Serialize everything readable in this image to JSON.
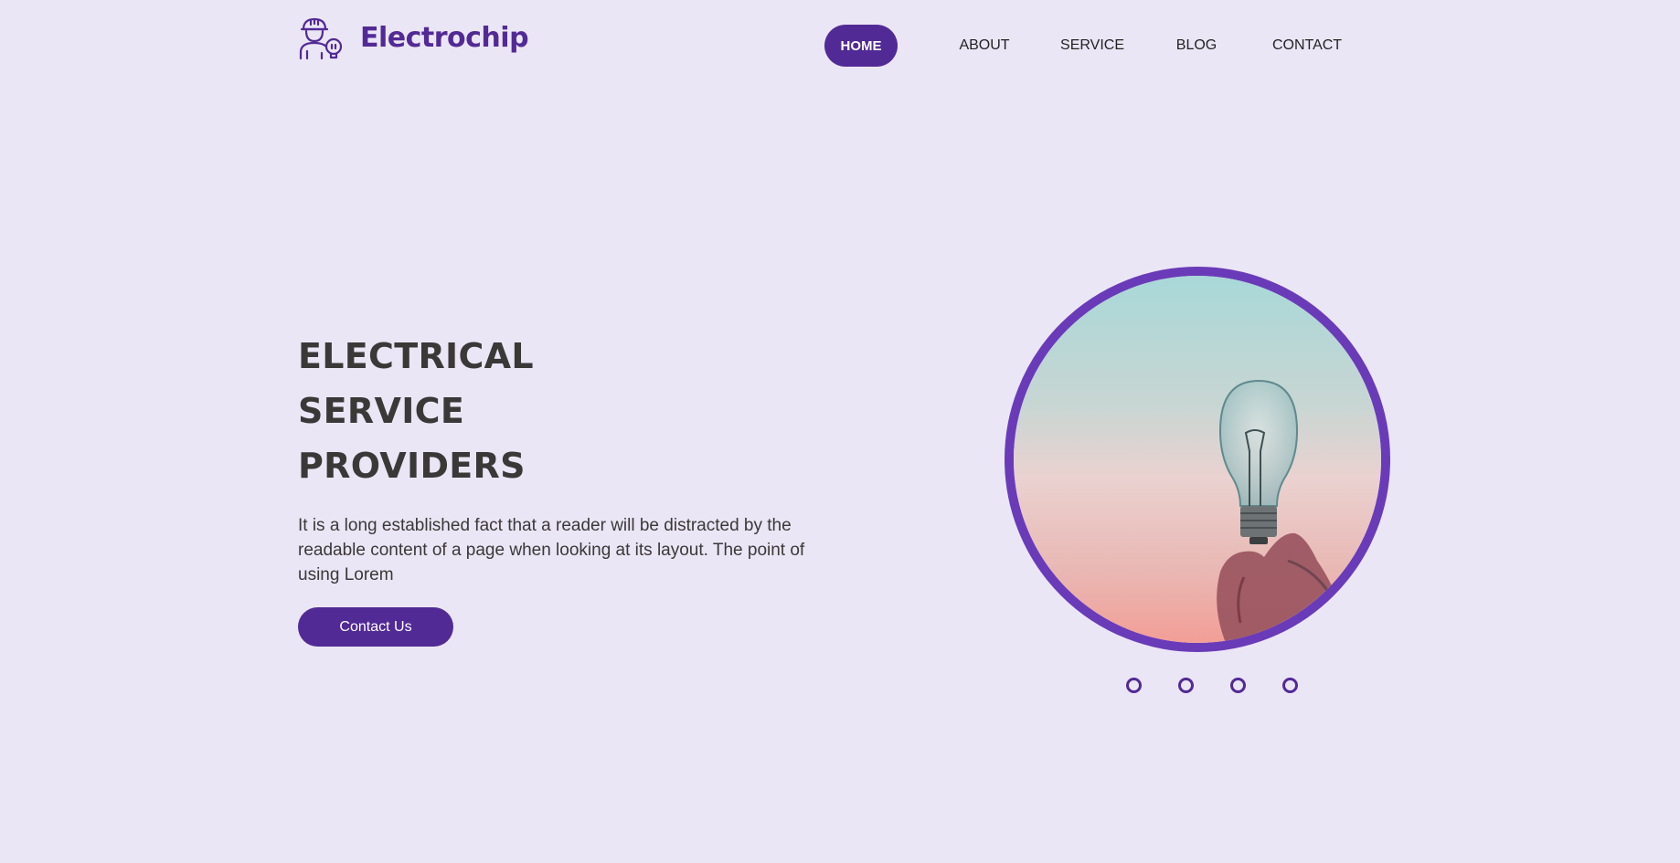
{
  "brand": {
    "name": "Electrochip",
    "logo_icon": "electrician-bulb-icon",
    "color": "#522a96"
  },
  "nav": {
    "items": [
      {
        "label": "HOME",
        "active": true
      },
      {
        "label": "ABOUT",
        "active": false
      },
      {
        "label": "SERVICE",
        "active": false
      },
      {
        "label": "BLOG",
        "active": false
      },
      {
        "label": "CONTACT",
        "active": false
      }
    ]
  },
  "hero": {
    "title_lines": [
      "ELECTRICAL",
      "SERVICE",
      "PROVIDERS"
    ],
    "description": "It is a long established fact that a reader will be distracted by the readable content of a page when looking at its layout. The point of using Lorem",
    "cta_label": "Contact Us",
    "image_icon": "hand-holding-lightbulb-photo"
  },
  "carousel": {
    "dot_count": 4,
    "active_index": 0
  },
  "colors": {
    "background": "#ebe6f5",
    "accent": "#522a96",
    "ring": "#6a3bb8",
    "heading": "#3b3838"
  }
}
